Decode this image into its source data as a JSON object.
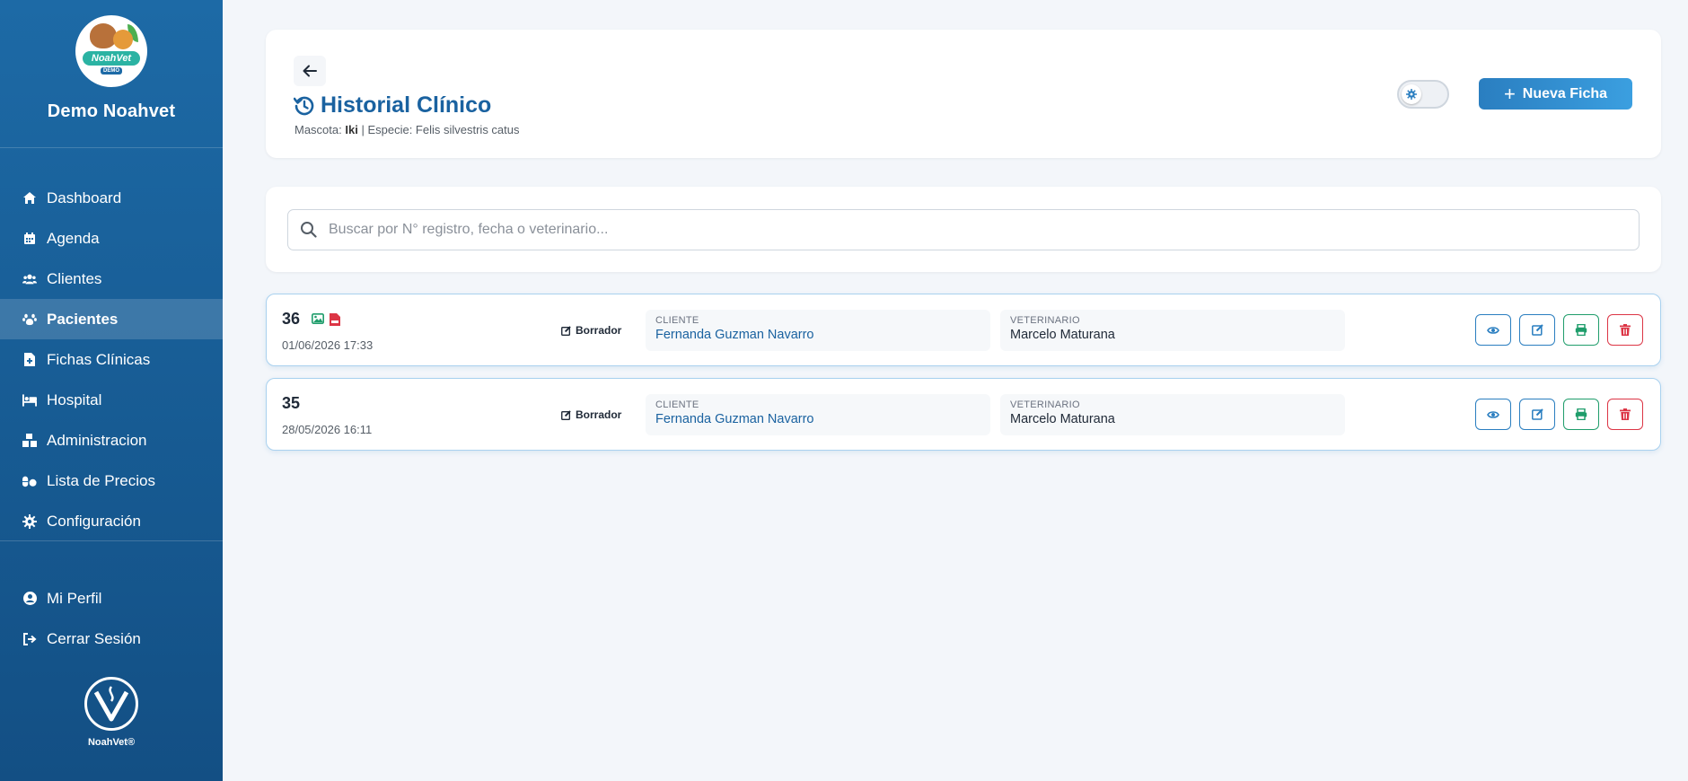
{
  "sidebar": {
    "brand_name": "Demo Noahvet",
    "logo_text": "NoahVet",
    "logo_sub": "DEMO",
    "items": [
      {
        "label": "Dashboard",
        "icon": "home-icon"
      },
      {
        "label": "Agenda",
        "icon": "calendar-icon"
      },
      {
        "label": "Clientes",
        "icon": "users-icon"
      },
      {
        "label": "Pacientes",
        "icon": "paw-icon",
        "active": true
      },
      {
        "label": "Fichas Clínicas",
        "icon": "file-medical-icon"
      },
      {
        "label": "Hospital",
        "icon": "hospital-bed-icon"
      },
      {
        "label": "Administracion",
        "icon": "boxes-icon"
      },
      {
        "label": "Lista de Precios",
        "icon": "pills-icon"
      },
      {
        "label": "Configuración",
        "icon": "gear-icon"
      }
    ],
    "bottom_items": [
      {
        "label": "Mi Perfil",
        "icon": "user-circle-icon"
      },
      {
        "label": "Cerrar Sesión",
        "icon": "sign-out-icon"
      }
    ],
    "footer_text": "NoahVet®"
  },
  "header": {
    "title": "Historial Clínico",
    "pet_label": "Mascota:",
    "pet_name": "Iki",
    "species_text": "| Especie: Felis silvestris catus",
    "new_button_label": "Nueva Ficha"
  },
  "search": {
    "placeholder": "Buscar por N° registro, fecha o veterinario..."
  },
  "records": [
    {
      "number": "36",
      "date": "01/06/2026 17:33",
      "status": "Borrador",
      "client_label": "CLIENTE",
      "client": "Fernanda Guzman Navarro",
      "vet_label": "VETERINARIO",
      "vet": "Marcelo Maturana",
      "has_attachments": true
    },
    {
      "number": "35",
      "date": "28/05/2026 16:11",
      "status": "Borrador",
      "client_label": "CLIENTE",
      "client": "Fernanda Guzman Navarro",
      "vet_label": "VETERINARIO",
      "vet": "Marcelo Maturana",
      "has_attachments": false
    }
  ],
  "colors": {
    "primary": "#1a62a0",
    "success": "#1f9d6b",
    "danger": "#dc3545"
  }
}
